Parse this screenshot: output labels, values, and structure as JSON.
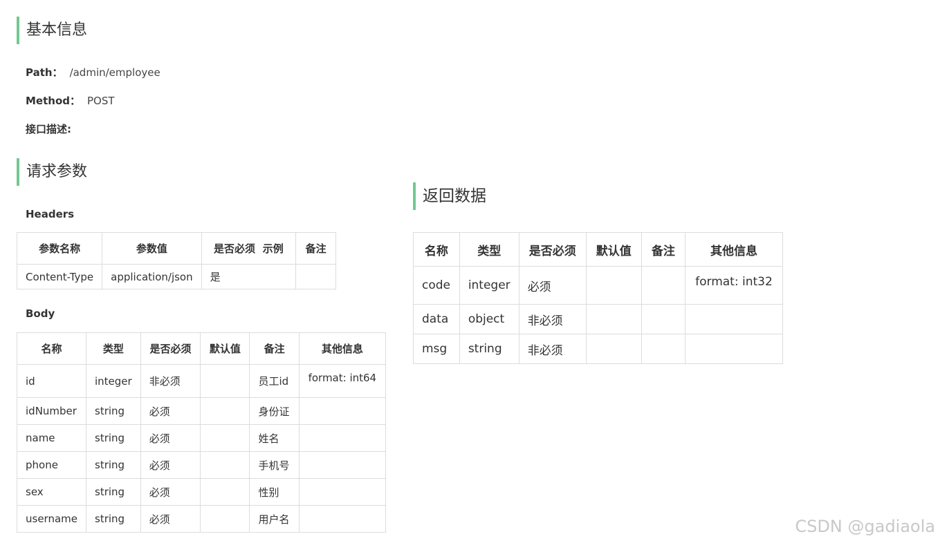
{
  "basic": {
    "title": "基本信息",
    "path_label": "Path：",
    "path_value": "/admin/employee",
    "method_label": "Method：",
    "method_value": "POST",
    "desc_label": "接口描述:"
  },
  "request": {
    "title": "请求参数",
    "headers_label": "Headers",
    "headers_columns": [
      "参数名称",
      "参数值",
      "是否必须",
      "示例",
      "备注"
    ],
    "headers_rows": [
      [
        "Content-Type",
        "application/json",
        "是",
        "",
        ""
      ]
    ],
    "body_label": "Body",
    "body_columns": [
      "名称",
      "类型",
      "是否必须",
      "默认值",
      "备注",
      "其他信息"
    ],
    "body_rows": [
      [
        "id",
        "integer",
        "非必须",
        "",
        "员工id",
        "format: int64"
      ],
      [
        "idNumber",
        "string",
        "必须",
        "",
        "身份证",
        ""
      ],
      [
        "name",
        "string",
        "必须",
        "",
        "姓名",
        ""
      ],
      [
        "phone",
        "string",
        "必须",
        "",
        "手机号",
        ""
      ],
      [
        "sex",
        "string",
        "必须",
        "",
        "性别",
        ""
      ],
      [
        "username",
        "string",
        "必须",
        "",
        "用户名",
        ""
      ]
    ]
  },
  "response": {
    "title": "返回数据",
    "columns": [
      "名称",
      "类型",
      "是否必须",
      "默认值",
      "备注",
      "其他信息"
    ],
    "rows": [
      [
        "code",
        "integer",
        "必须",
        "",
        "",
        "format: int32"
      ],
      [
        "data",
        "object",
        "非必须",
        "",
        "",
        ""
      ],
      [
        "msg",
        "string",
        "非必须",
        "",
        "",
        ""
      ]
    ]
  },
  "watermark": "CSDN @gadiaola",
  "colors": {
    "accent_bar": "#73c991",
    "border": "#dcdcdc",
    "text": "#333333"
  }
}
